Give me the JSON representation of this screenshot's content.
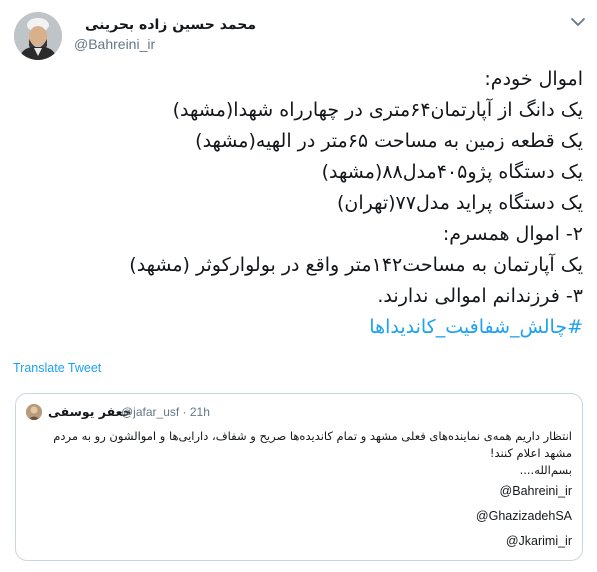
{
  "author": {
    "name": "محمد حسین زاده بحرینی",
    "handle": "@Bahreini_ir"
  },
  "tweet_lines": [
    "اموال خودم:",
    "یک دانگ از آپارتمان۶۴متری در چهارراه شهدا(مشهد)",
    "یک قطعه زمین به مساحت ۶۵متر در الهیه(مشهد)",
    "یک دستگاه پژو۴۰۵مدل۸۸(مشهد)",
    "یک دستگاه پراید مدل۷۷(تهران)",
    "۲- اموال همسرم:",
    "یک آپارتمان به مساحت۱۴۲متر واقع در بولوارکوثر (مشهد)",
    "۳- فرزندانم اموالی ندارند."
  ],
  "hashtag": "#چالش_شفافیت_کاندیداها",
  "translate_label": "Translate Tweet",
  "quoted": {
    "name": "جعفر یوسفی",
    "meta": "@jafar_usf · 21h",
    "lines": [
      "انتظار داریم همه‌ی نماینده‌های فعلی مشهد و تمام کاندیده‌ها صریح و شفاف، دارایی‌ها و اموالشون رو به مردم",
      "مشهد اعلام کنند!",
      "بسم‌الله...."
    ],
    "mentions": [
      "@Bahreini_ir",
      "@GhazizadehSA",
      "@Jkarimi_ir"
    ]
  },
  "icons": {
    "menu": "chevron-down-icon",
    "avatar": "avatar",
    "quoted_avatar": "avatar"
  },
  "colors": {
    "link": "#1da1f2",
    "secondary_text": "#657786",
    "border": "#ccd6dd"
  }
}
